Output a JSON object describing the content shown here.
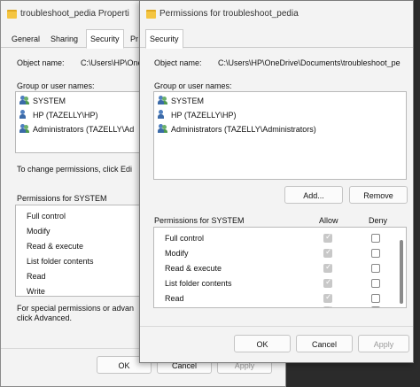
{
  "back_window": {
    "title": "troubleshoot_pedia Properti",
    "tabs": [
      "General",
      "Sharing",
      "Security",
      "Pr"
    ],
    "object_name_label": "Object name:",
    "object_name_value": "C:\\Users\\HP\\One",
    "group_label": "Group or user names:",
    "users": [
      "SYSTEM",
      "HP (TAZELLY\\HP)",
      "Administrators (TAZELLY\\Ad"
    ],
    "change_text": "To change permissions, click Edi",
    "perm_label": "Permissions for SYSTEM",
    "permissions": [
      "Full control",
      "Modify",
      "Read & execute",
      "List folder contents",
      "Read",
      "Write"
    ],
    "special_text_1": "For special permissions or advan",
    "special_text_2": "click Advanced.",
    "ok": "OK",
    "cancel": "Cancel",
    "apply": "Apply"
  },
  "front_window": {
    "title": "Permissions for troubleshoot_pedia",
    "tab": "Security",
    "object_name_label": "Object name:",
    "object_name_value": "C:\\Users\\HP\\OneDrive\\Documents\\troubleshoot_pe",
    "group_label": "Group or user names:",
    "users": [
      "SYSTEM",
      "HP (TAZELLY\\HP)",
      "Administrators (TAZELLY\\Administrators)"
    ],
    "add": "Add...",
    "remove": "Remove",
    "perm_label": "Permissions for SYSTEM",
    "allow_label": "Allow",
    "deny_label": "Deny",
    "permissions": [
      {
        "name": "Full control",
        "allow": true,
        "deny": false
      },
      {
        "name": "Modify",
        "allow": true,
        "deny": false
      },
      {
        "name": "Read & execute",
        "allow": true,
        "deny": false
      },
      {
        "name": "List folder contents",
        "allow": true,
        "deny": false
      },
      {
        "name": "Read",
        "allow": true,
        "deny": false
      }
    ],
    "ok": "OK",
    "cancel": "Cancel",
    "apply": "Apply"
  }
}
